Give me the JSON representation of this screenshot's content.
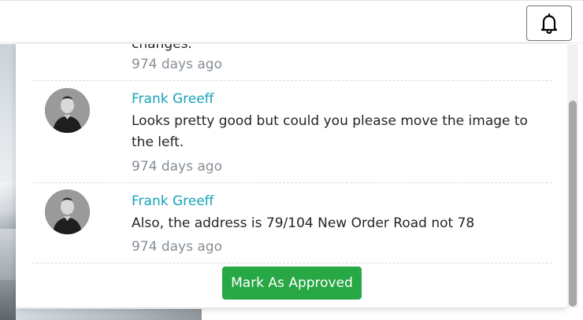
{
  "header": {
    "notifications_icon": "bell-icon"
  },
  "comments": {
    "partial": {
      "text_tail": "changes.",
      "time": "974 days ago"
    },
    "items": [
      {
        "author": "Frank Greeff",
        "message": "Looks pretty good but could you please move the image to the left.",
        "time": "974 days ago"
      },
      {
        "author": "Frank Greeff",
        "message": "Also, the address is 79/104 New Order Road not 78",
        "time": "974 days ago"
      }
    ]
  },
  "actions": {
    "approve_label": "Mark As Approved"
  },
  "colors": {
    "author": "#17a2b8",
    "approve_button": "#28a745",
    "muted_text": "#868e96"
  }
}
